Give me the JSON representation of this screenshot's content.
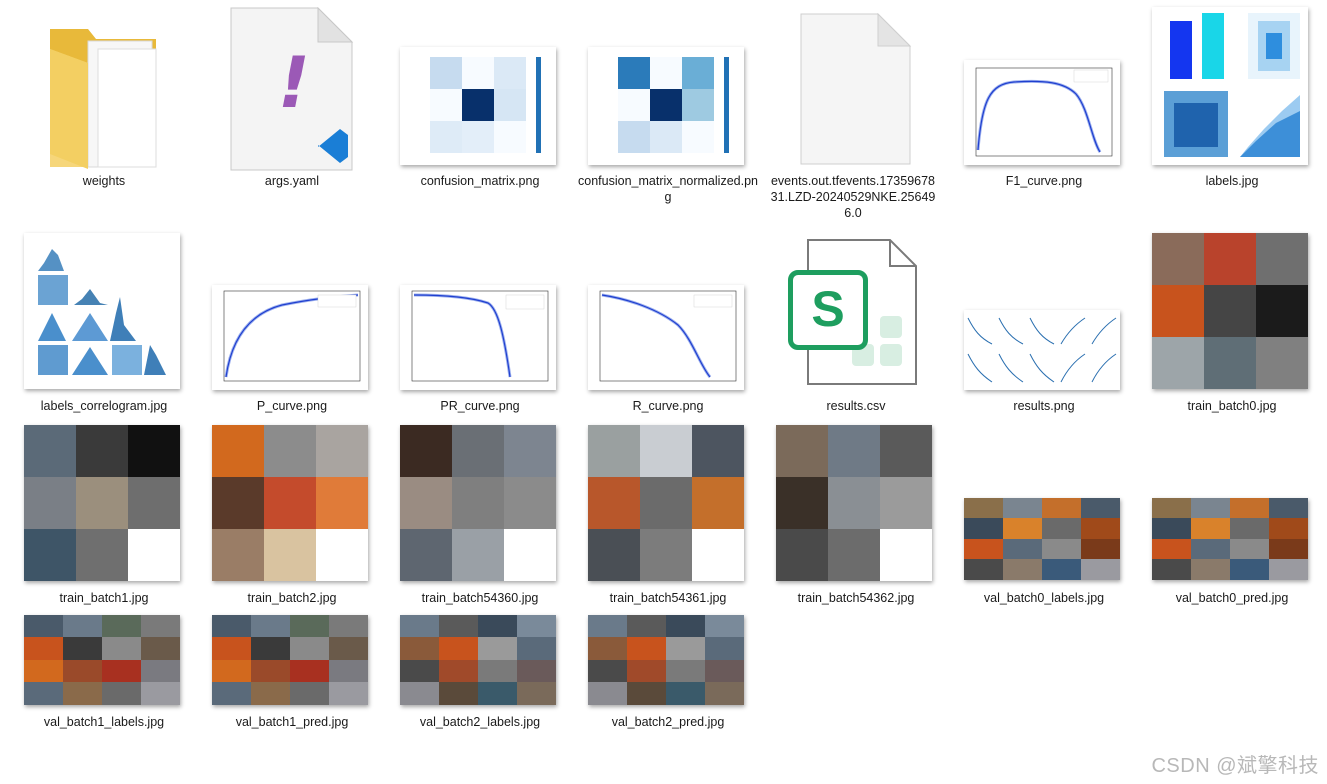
{
  "files": [
    {
      "name": "weights",
      "kind": "folder"
    },
    {
      "name": "args.yaml",
      "kind": "yaml"
    },
    {
      "name": "confusion_matrix.png",
      "kind": "png"
    },
    {
      "name": "confusion_matrix_normalized.png",
      "kind": "png"
    },
    {
      "name": "events.out.tfevents.1735967831.LZD-20240529NKE.256496.0",
      "kind": "blank"
    },
    {
      "name": "F1_curve.png",
      "kind": "png"
    },
    {
      "name": "labels.jpg",
      "kind": "jpg"
    },
    {
      "name": "labels_correlogram.jpg",
      "kind": "jpg"
    },
    {
      "name": "P_curve.png",
      "kind": "png"
    },
    {
      "name": "PR_curve.png",
      "kind": "png"
    },
    {
      "name": "R_curve.png",
      "kind": "png"
    },
    {
      "name": "results.csv",
      "kind": "csv"
    },
    {
      "name": "results.png",
      "kind": "png"
    },
    {
      "name": "train_batch0.jpg",
      "kind": "jpg"
    },
    {
      "name": "train_batch1.jpg",
      "kind": "jpg"
    },
    {
      "name": "train_batch2.jpg",
      "kind": "jpg"
    },
    {
      "name": "train_batch54360.jpg",
      "kind": "jpg"
    },
    {
      "name": "train_batch54361.jpg",
      "kind": "jpg"
    },
    {
      "name": "train_batch54362.jpg",
      "kind": "jpg"
    },
    {
      "name": "val_batch0_labels.jpg",
      "kind": "jpg"
    },
    {
      "name": "val_batch0_pred.jpg",
      "kind": "jpg"
    },
    {
      "name": "val_batch1_labels.jpg",
      "kind": "jpg"
    },
    {
      "name": "val_batch1_pred.jpg",
      "kind": "jpg"
    },
    {
      "name": "val_batch2_labels.jpg",
      "kind": "jpg"
    },
    {
      "name": "val_batch2_pred.jpg",
      "kind": "jpg"
    }
  ],
  "csv_icon_letter": "S",
  "yaml_icon_glyph": "!",
  "watermark": "CSDN @斌擎科技",
  "colors": {
    "folder": "#f2c94c",
    "blue_curve": "#1f3fcf",
    "matrix_dark": "#08306b",
    "csv_green": "#1e9e5f",
    "yaml_purple": "#9b59b6",
    "vscode_blue": "#1a7ed6"
  }
}
